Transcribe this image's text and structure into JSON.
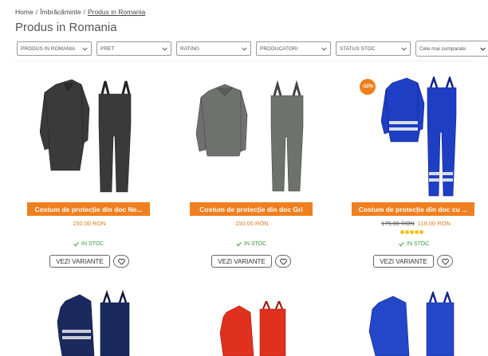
{
  "breadcrumb": {
    "home": "Home",
    "sep1": "/",
    "category": "Îmbrăcăminte",
    "sep2": "/",
    "current": "Produs in Romania"
  },
  "page_title": "Produs in Romania",
  "filters": [
    {
      "label": "PRODUS IN ROMANIA"
    },
    {
      "label": "PRET"
    },
    {
      "label": "RATING"
    },
    {
      "label": "PRODUCATORI"
    },
    {
      "label": "STATUS STOC"
    }
  ],
  "sort": {
    "label": "Cele mai cumparate"
  },
  "colors": {
    "accent": "#f07f1f",
    "in_stock": "#3a9b3a",
    "star": "#f0c419"
  },
  "products": [
    {
      "name": "Costum de protecție din doc Ne...",
      "price": "150,00 RON",
      "old_price": "",
      "stock": "IN STOC",
      "variants_label": "VEZI VARIANTE",
      "badge": "",
      "rating_stars": 0
    },
    {
      "name": "Costum de protecție din doc Gri",
      "price": "150,00 RON",
      "old_price": "",
      "stock": "IN STOC",
      "variants_label": "VEZI VARIANTE",
      "badge": "",
      "rating_stars": 0
    },
    {
      "name": "Costum de protecție din doc cu ...",
      "price": "119,00 RON",
      "old_price": "175,00 RON",
      "stock": "IN STOC",
      "variants_label": "VEZI VARIANTE",
      "badge": "-32%",
      "rating_stars": 5
    }
  ],
  "icons": {
    "chevron": "chevron-down-icon",
    "check": "check-icon",
    "heart": "heart-icon"
  }
}
